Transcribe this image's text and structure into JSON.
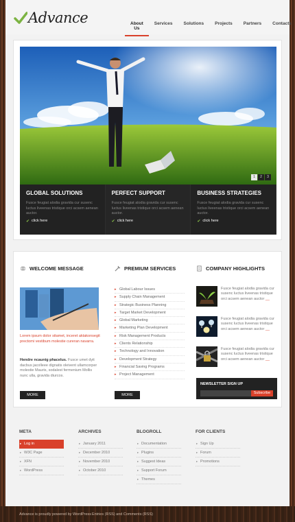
{
  "brand": {
    "name": "Advance"
  },
  "nav": {
    "items": [
      "About Us",
      "Services",
      "Solutions",
      "Projects",
      "Partners",
      "Contacts"
    ],
    "active_index": 0
  },
  "slider": {
    "pages": [
      "1",
      "2",
      "3"
    ],
    "active_page": "1"
  },
  "features": [
    {
      "title": "GLOBAL SOLUTIONS",
      "text": "Fusce feugiat alodia gravida cur susenc luctus liveenas tristique orci acsem aenean auctor.",
      "link": "click here"
    },
    {
      "title": "PERFECT SUPPORT",
      "text": "Fusce feugiat alodia gravida cur susenc luctus liveenas tristique orci acsem aenean auctor.",
      "link": "click here"
    },
    {
      "title": "BUSINESS STRATEGIES",
      "text": "Fusce feugiat alodia gravida cur susenc luctus liveenas tristique orci acsem aenean auctor.",
      "link": "click here"
    }
  ],
  "welcome": {
    "title": "WELCOME MESSAGE",
    "intro": "Lorem ipsum dolor sitamet, inceret aktakonsegit prectomi vestibum molestie cureran navarra.",
    "body_bold": "Hendre ncaunig phacelus.",
    "body": "Fusce umet dyit dacbus jacolleee dignatis oleivent ullamcorper molestie Mauris, sodalest fermenium Mollis nunc ulla, gravida diurcos.",
    "more": "MORE"
  },
  "services": {
    "title": "PREMIUM SERVICES",
    "items": [
      "Global Labour Issues",
      "Supply Chain Management",
      "Strategic Business Planning",
      "Target Market Development",
      "Global Marketing",
      "Marketing Plan Development",
      "Risk Management Products",
      "Clients Relationship",
      "Technology and Innovation",
      "Development Strategy",
      "Financial Saving Programs",
      "Project Management"
    ],
    "more": "MORE"
  },
  "highlights": {
    "title": "COMPANY HIGHLIGHTS",
    "items": [
      {
        "text": "Fusce feugiat alodia gravida cur susenc luctus liveenas tristique orci acsem aenean auctor",
        "dash": "__"
      },
      {
        "text": "Fusce feugiat alodia gravida cur susenc luctus liveenas tristique orci acsem aenean auctor",
        "dash": "__"
      },
      {
        "text": "Fusce feugiat alodia gravida cur susenc luctus liveenas tristique orci acsem aenean auctor",
        "dash": "__"
      }
    ]
  },
  "newsletter": {
    "title": "NEWSLETTER SIGN UP",
    "button": "Subscribe"
  },
  "footer": {
    "meta": {
      "title": "META",
      "items": [
        "Log in",
        "W3C Page",
        "XFN",
        "WordPress"
      ],
      "active_index": 0
    },
    "archives": {
      "title": "ARCHIVES",
      "items": [
        "January 2011",
        "December 2010",
        "November 2010",
        "October 2010"
      ]
    },
    "blogroll": {
      "title": "BLOGROLL",
      "items": [
        "Documentation",
        "Plugins",
        "Suggest Ideas",
        "Support Forum",
        "Themes"
      ]
    },
    "clients": {
      "title": "FOR CLIENTS",
      "items": [
        "Sign Up",
        "Forum",
        "Promotions"
      ]
    }
  },
  "bottom": {
    "credit": "Advance is proudly powered by WordPress",
    "feeds": "Entries (RSS) and Comments (RSS)"
  },
  "colors": {
    "accent": "#d9412b",
    "dark": "#222222",
    "check": "#7cb342"
  }
}
